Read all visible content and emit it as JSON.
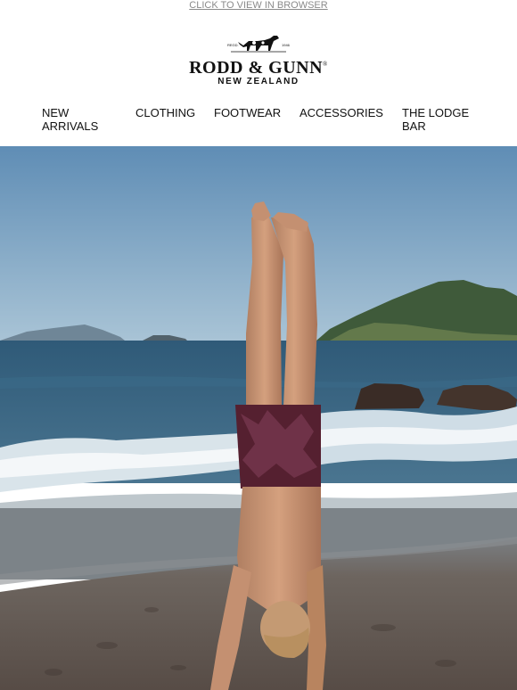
{
  "header": {
    "view_in_browser": "CLICK TO VIEW IN BROWSER",
    "logo": {
      "name": "RODD & GUNN",
      "trademark": "®",
      "tagline": "NEW ZEALAND",
      "emblem_left": "REGD.",
      "emblem_right": "1946"
    }
  },
  "nav": {
    "items": [
      {
        "label": "NEW ARRIVALS"
      },
      {
        "label": "CLOTHING"
      },
      {
        "label": "FOOTWEAR"
      },
      {
        "label": "ACCESSORIES"
      },
      {
        "label": "THE LODGE BAR"
      }
    ]
  },
  "colors": {
    "sky_top": "#5f8db5",
    "sky_bottom": "#a9c4d6",
    "sea": "#39627f",
    "sand": "#6e625c",
    "link_grey": "#8a8a8a"
  }
}
